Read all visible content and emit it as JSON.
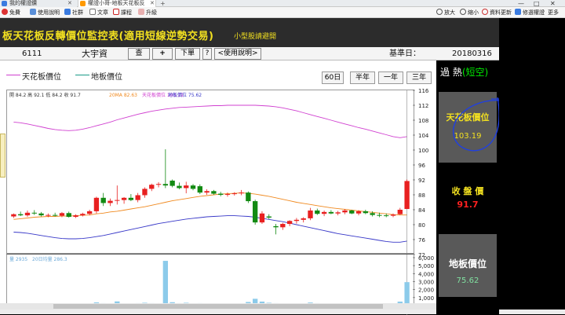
{
  "browser": {
    "tabs": [
      {
        "label": "我的權證鑽",
        "icon_color": "#3a7be0"
      },
      {
        "label": "權證小哥-地板天花板反",
        "icon_color": "#ff9900"
      }
    ],
    "toolbar_left": [
      {
        "label": "免費",
        "icon": "gift-icon",
        "color": "#d33"
      },
      {
        "label": "使用說明",
        "icon": "help-icon",
        "color": "#5a8fd8"
      },
      {
        "label": "社群",
        "icon": "people-icon",
        "color": "#3a7be0"
      },
      {
        "label": "文章",
        "icon": "doc-icon",
        "color": "#777"
      },
      {
        "label": "課程",
        "icon": "video-icon",
        "color": "#c22"
      },
      {
        "label": "升級",
        "icon": "upgrade-icon",
        "color": "#d99"
      }
    ],
    "toolbar_right": [
      {
        "label": "放大",
        "icon": "zoom-in-icon"
      },
      {
        "label": "縮小",
        "icon": "zoom-out-icon"
      },
      {
        "label": "資料更新",
        "icon": "refresh-icon"
      },
      {
        "label": "修選權證",
        "icon": "filter-icon"
      },
      {
        "label": "更多",
        "icon": "more-icon"
      }
    ],
    "user_label": "…",
    "window_controls": [
      "—",
      "□",
      "✕"
    ]
  },
  "header": {
    "title": "板天花板反轉價位監控表(適用短線逆勢交易)",
    "subtitle": "小型股請避開",
    "title_color": "#f2e020"
  },
  "infobar": {
    "stock_code": "6111",
    "stock_name": "大宇資",
    "query_button": "查",
    "add_button": "+",
    "order_button": "下單",
    "help_button": "?",
    "guide_button": "<使用說明>",
    "base_date_label": "基準日：",
    "base_date": "20180316"
  },
  "legend": {
    "ceiling": {
      "label": "天花板價位",
      "color": "#d040d0"
    },
    "floor": {
      "label": "地板價位",
      "color": "#1a9a88"
    }
  },
  "periods": [
    "60日",
    "半年",
    "一年",
    "三年"
  ],
  "price_info": {
    "ohlc_text": "開 84.2  高 92.1  低 84.2  收 91.7",
    "ma_text": "20MA 82.63",
    "ceiling_text": "天花板價位 103.19",
    "floor_text": "地板價位 75.62"
  },
  "volume_info": {
    "volume_text": "量 2935",
    "vma_text": "20日均量 286.3"
  },
  "side": {
    "overheat_prefix": "過 熱",
    "overheat_highlight": "(短空)",
    "ceiling_label": "天花板價位",
    "ceiling_value": "103.19",
    "close_label": "收 盤 價",
    "close_value": "91.7",
    "floor_label": "地板價位",
    "floor_value": "75.62",
    "colors": {
      "label": "#f2e020",
      "ceiling_value": "#f2e020",
      "close_value": "#ff2020",
      "floor_value": "#80e0a0"
    }
  },
  "chart_data": {
    "type": "candlestick",
    "price_ylim": [
      72,
      116
    ],
    "price_ticks": [
      "72",
      "76",
      "80",
      "84",
      "88",
      "92",
      "96",
      "100",
      "104",
      "108",
      "112",
      "116"
    ],
    "volume_ylim": [
      0,
      6000
    ],
    "volume_ticks": [
      "1,000",
      "2,000",
      "3,000",
      "4,000",
      "5,000",
      "6,000"
    ],
    "colors": {
      "up": "#e82020",
      "down": "#128a12",
      "ma20": "#f08a20",
      "ceiling": "#d040d0",
      "floor": "#3838c8",
      "volume": "#8ccbea"
    },
    "candles": [
      {
        "o": 82.2,
        "h": 83.0,
        "l": 81.8,
        "c": 82.8
      },
      {
        "o": 82.8,
        "h": 83.5,
        "l": 82.3,
        "c": 82.5
      },
      {
        "o": 82.5,
        "h": 83.8,
        "l": 82.1,
        "c": 83.2
      },
      {
        "o": 83.2,
        "h": 83.9,
        "l": 82.6,
        "c": 83.0
      },
      {
        "o": 83.0,
        "h": 83.4,
        "l": 82.2,
        "c": 82.5
      },
      {
        "o": 82.5,
        "h": 83.0,
        "l": 82.0,
        "c": 82.6
      },
      {
        "o": 82.6,
        "h": 83.2,
        "l": 82.2,
        "c": 82.4
      },
      {
        "o": 82.4,
        "h": 83.4,
        "l": 82.0,
        "c": 83.1
      },
      {
        "o": 83.1,
        "h": 83.5,
        "l": 81.9,
        "c": 82.1
      },
      {
        "o": 82.1,
        "h": 82.8,
        "l": 81.8,
        "c": 82.5
      },
      {
        "o": 82.5,
        "h": 83.2,
        "l": 82.2,
        "c": 82.9
      },
      {
        "o": 82.9,
        "h": 84.0,
        "l": 82.5,
        "c": 83.6
      },
      {
        "o": 83.6,
        "h": 87.5,
        "l": 83.0,
        "c": 87.2
      },
      {
        "o": 87.2,
        "h": 88.5,
        "l": 85.0,
        "c": 85.8
      },
      {
        "o": 85.8,
        "h": 87.0,
        "l": 85.0,
        "c": 86.4
      },
      {
        "o": 86.4,
        "h": 90.5,
        "l": 85.4,
        "c": 86.6
      },
      {
        "o": 86.6,
        "h": 87.4,
        "l": 85.6,
        "c": 87.2
      },
      {
        "o": 87.2,
        "h": 88.2,
        "l": 86.3,
        "c": 86.6
      },
      {
        "o": 86.6,
        "h": 88.5,
        "l": 86.0,
        "c": 87.9
      },
      {
        "o": 87.9,
        "h": 90.0,
        "l": 87.2,
        "c": 89.6
      },
      {
        "o": 89.6,
        "h": 91.0,
        "l": 89.0,
        "c": 90.7
      },
      {
        "o": 90.7,
        "h": 91.4,
        "l": 90.0,
        "c": 90.9
      },
      {
        "o": 90.9,
        "h": 100.2,
        "l": 89.8,
        "c": 90.5
      },
      {
        "o": 91.8,
        "h": 92.1,
        "l": 90.0,
        "c": 90.4
      },
      {
        "o": 90.4,
        "h": 91.3,
        "l": 89.5,
        "c": 89.8
      },
      {
        "o": 89.8,
        "h": 91.5,
        "l": 88.4,
        "c": 90.5
      },
      {
        "o": 90.5,
        "h": 90.9,
        "l": 89.2,
        "c": 89.6
      },
      {
        "o": 90.3,
        "h": 90.8,
        "l": 88.2,
        "c": 88.6
      },
      {
        "o": 88.6,
        "h": 89.5,
        "l": 88.0,
        "c": 89.0
      },
      {
        "o": 89.0,
        "h": 89.3,
        "l": 88.0,
        "c": 88.3
      },
      {
        "o": 88.3,
        "h": 88.8,
        "l": 87.6,
        "c": 88.0
      },
      {
        "o": 88.0,
        "h": 88.6,
        "l": 87.5,
        "c": 88.2
      },
      {
        "o": 88.2,
        "h": 88.7,
        "l": 87.8,
        "c": 88.4
      },
      {
        "o": 88.4,
        "h": 89.3,
        "l": 87.9,
        "c": 88.6
      },
      {
        "o": 88.6,
        "h": 88.9,
        "l": 85.8,
        "c": 86.3
      },
      {
        "o": 86.3,
        "h": 86.7,
        "l": 80.0,
        "c": 80.6
      },
      {
        "o": 80.6,
        "h": 83.6,
        "l": 80.2,
        "c": 83.0
      },
      {
        "o": 82.2,
        "h": 82.8,
        "l": 81.5,
        "c": 81.9
      },
      {
        "o": 79.6,
        "h": 80.2,
        "l": 77.4,
        "c": 79.3
      },
      {
        "o": 79.3,
        "h": 80.5,
        "l": 78.6,
        "c": 80.2
      },
      {
        "o": 80.2,
        "h": 81.2,
        "l": 79.6,
        "c": 81.0
      },
      {
        "o": 81.0,
        "h": 81.8,
        "l": 80.3,
        "c": 81.3
      },
      {
        "o": 81.3,
        "h": 82.0,
        "l": 80.6,
        "c": 81.7
      },
      {
        "o": 81.7,
        "h": 84.5,
        "l": 81.2,
        "c": 83.8
      },
      {
        "o": 83.8,
        "h": 84.3,
        "l": 82.6,
        "c": 82.9
      },
      {
        "o": 82.9,
        "h": 83.8,
        "l": 82.3,
        "c": 83.4
      },
      {
        "o": 83.4,
        "h": 83.9,
        "l": 82.8,
        "c": 83.0
      },
      {
        "o": 83.0,
        "h": 83.7,
        "l": 82.5,
        "c": 83.3
      },
      {
        "o": 83.3,
        "h": 84.2,
        "l": 82.8,
        "c": 83.8
      },
      {
        "o": 83.8,
        "h": 84.0,
        "l": 82.8,
        "c": 83.0
      },
      {
        "o": 83.0,
        "h": 83.9,
        "l": 82.5,
        "c": 83.6
      },
      {
        "o": 83.6,
        "h": 84.0,
        "l": 82.8,
        "c": 83.1
      },
      {
        "o": 83.1,
        "h": 83.6,
        "l": 82.2,
        "c": 82.6
      },
      {
        "o": 82.6,
        "h": 83.2,
        "l": 82.0,
        "c": 82.5
      },
      {
        "o": 82.5,
        "h": 83.0,
        "l": 82.0,
        "c": 82.4
      },
      {
        "o": 82.4,
        "h": 83.0,
        "l": 82.0,
        "c": 82.7
      },
      {
        "o": 82.8,
        "h": 84.5,
        "l": 82.6,
        "c": 84.0
      },
      {
        "o": 84.2,
        "h": 92.1,
        "l": 84.2,
        "c": 91.7
      }
    ],
    "ma20": [
      81.4,
      81.6,
      81.8,
      82.0,
      82.1,
      82.2,
      82.2,
      82.3,
      82.3,
      82.4,
      82.5,
      82.6,
      82.9,
      83.1,
      83.4,
      83.6,
      83.9,
      84.2,
      84.5,
      84.8,
      85.2,
      85.6,
      86.0,
      86.4,
      86.7,
      87.0,
      87.3,
      87.6,
      87.8,
      88.0,
      88.2,
      88.3,
      88.4,
      88.5,
      88.4,
      88.2,
      87.9,
      87.6,
      87.2,
      86.8,
      86.4,
      86.0,
      85.7,
      85.4,
      85.1,
      84.8,
      84.5,
      84.3,
      84.1,
      83.9,
      83.7,
      83.5,
      83.3,
      83.1,
      82.9,
      82.7,
      82.6,
      82.6
    ],
    "ceiling": [
      107.5,
      107.3,
      107.0,
      106.6,
      106.2,
      105.8,
      105.5,
      105.3,
      105.2,
      105.3,
      105.6,
      106.0,
      106.5,
      107.0,
      107.5,
      108.1,
      108.6,
      109.1,
      109.6,
      110.0,
      110.4,
      110.7,
      111.0,
      111.2,
      111.4,
      111.5,
      111.6,
      111.7,
      111.8,
      111.9,
      111.9,
      112.0,
      112.0,
      112.0,
      112.0,
      112.0,
      111.9,
      111.8,
      111.6,
      111.3,
      110.9,
      110.5,
      110.0,
      109.5,
      109.0,
      108.5,
      108.0,
      107.5,
      107.0,
      106.5,
      106.0,
      105.6,
      105.1,
      104.6,
      104.1,
      103.6,
      103.3,
      103.6
    ],
    "floor": [
      78.0,
      77.9,
      77.7,
      77.4,
      77.1,
      76.8,
      76.5,
      76.3,
      76.2,
      76.2,
      76.3,
      76.5,
      76.8,
      77.1,
      77.5,
      77.9,
      78.3,
      78.7,
      79.1,
      79.5,
      79.9,
      80.3,
      80.6,
      80.9,
      81.2,
      81.5,
      81.7,
      81.9,
      82.1,
      82.2,
      82.3,
      82.4,
      82.4,
      82.3,
      82.2,
      82.0,
      81.7,
      81.4,
      81.1,
      80.8,
      80.4,
      80.0,
      79.6,
      79.2,
      78.8,
      78.4,
      78.0,
      77.6,
      77.3,
      77.0,
      76.7,
      76.4,
      76.1,
      75.8,
      75.5,
      75.3,
      75.3,
      75.6
    ],
    "volume": [
      20,
      40,
      30,
      60,
      50,
      40,
      30,
      60,
      40,
      30,
      50,
      80,
      400,
      300,
      200,
      520,
      250,
      180,
      300,
      350,
      300,
      280,
      5600,
      420,
      300,
      350,
      240,
      300,
      250,
      200,
      180,
      200,
      220,
      230,
      450,
      850,
      500,
      350,
      300,
      250,
      230,
      250,
      240,
      380,
      300,
      250,
      250,
      240,
      280,
      260,
      240,
      250,
      240,
      230,
      220,
      230,
      500,
      2935
    ]
  }
}
